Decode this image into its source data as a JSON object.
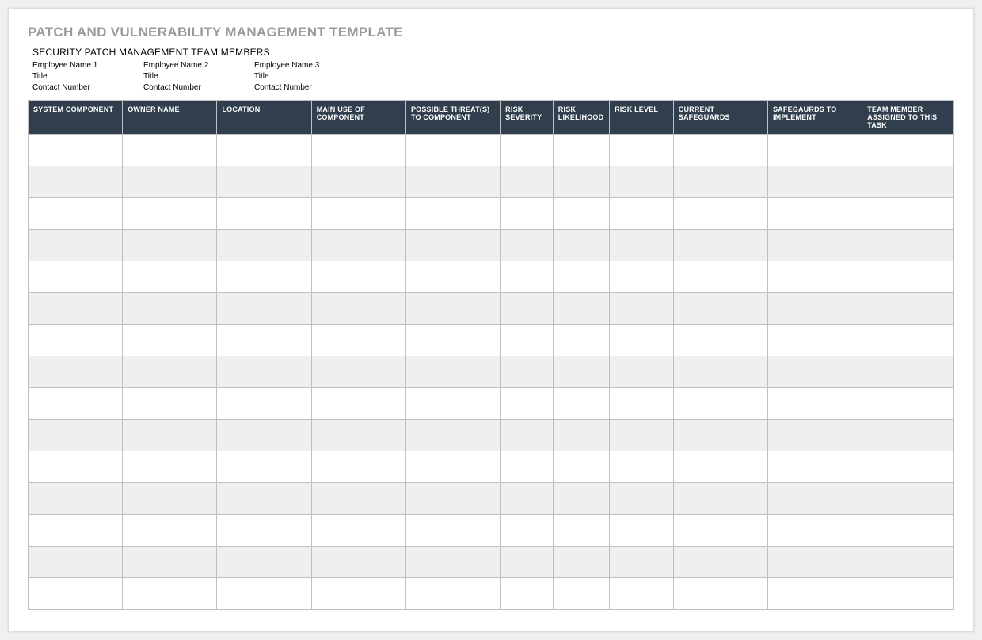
{
  "title": "PATCH AND VULNERABILITY MANAGEMENT TEMPLATE",
  "subtitle": "SECURITY PATCH MANAGEMENT TEAM MEMBERS",
  "team_members": [
    {
      "name": "Employee Name 1",
      "title": "Title",
      "contact": "Contact Number"
    },
    {
      "name": "Employee Name 2",
      "title": "Title",
      "contact": "Contact Number"
    },
    {
      "name": "Employee Name 3",
      "title": "Title",
      "contact": "Contact Number"
    }
  ],
  "table": {
    "headers": [
      "SYSTEM COMPONENT",
      "OWNER NAME",
      "LOCATION",
      "MAIN USE OF COMPONENT",
      "POSSIBLE THREAT(S) TO COMPONENT",
      "RISK SEVERITY",
      "RISK LIKELIHOOD",
      "RISK LEVEL",
      "CURRENT SAFEGUARDS",
      "SAFEGAURDS TO IMPLEMENT",
      "TEAM MEMBER ASSIGNED TO THIS TASK"
    ],
    "row_count": 15
  }
}
